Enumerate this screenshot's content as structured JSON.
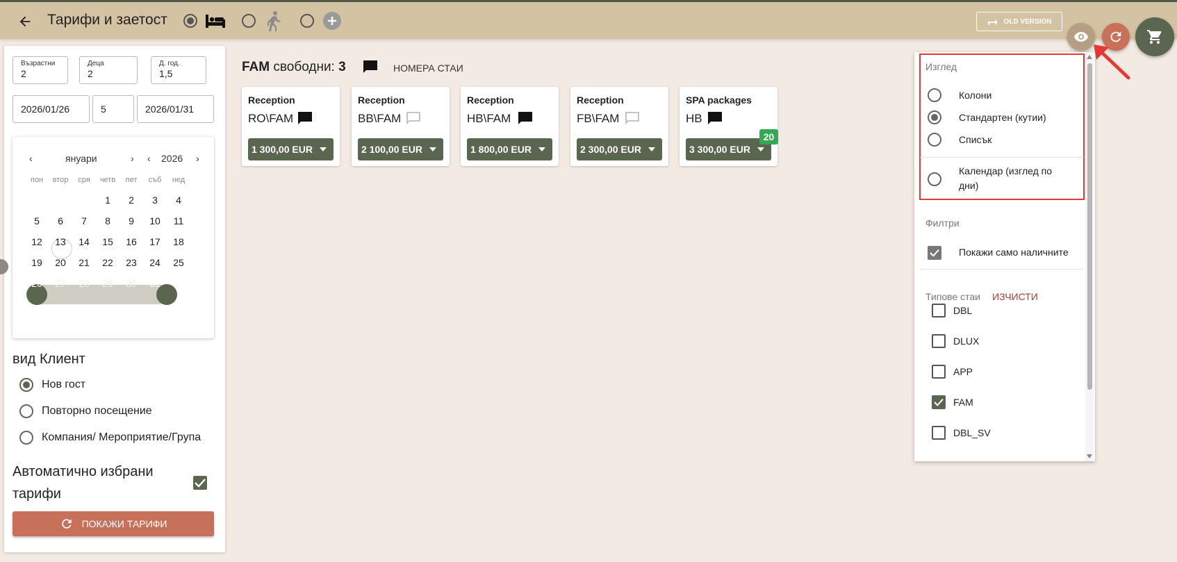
{
  "header": {
    "title": "Тарифи и заетост",
    "old_version_label": "OLD VERSION"
  },
  "search": {
    "adults_label": "Възрастни",
    "adults_value": "2",
    "children_label": "Деца",
    "children_value": "2",
    "child_age_label": "Д. год.",
    "child_age_value": "1,5",
    "date_from": "2026/01/26",
    "nights": "5",
    "date_to": "2026/01/31"
  },
  "calendar": {
    "month": "януари",
    "year": "2026",
    "weekdays": [
      "пон",
      "втор",
      "сря",
      "четв",
      "пет",
      "съб",
      "нед"
    ],
    "weeks": [
      [
        "",
        "",
        "",
        "1",
        "2",
        "3",
        "4"
      ],
      [
        "5",
        "6",
        "7",
        "8",
        "9",
        "10",
        "11"
      ],
      [
        "12",
        "13",
        "14",
        "15",
        "16",
        "17",
        "18"
      ],
      [
        "19",
        "20",
        "21",
        "22",
        "23",
        "24",
        "25"
      ],
      [
        "26",
        "27",
        "28",
        "29",
        "30",
        "31",
        ""
      ]
    ]
  },
  "client": {
    "title": "вид Клиент",
    "options": [
      "Нов гост",
      "Повторно посещение",
      "Компания/ Мероприятие/Група"
    ],
    "selected": "Нов гост",
    "auto_rates_label": "Автоматично избрани тарифи",
    "auto_rates_checked": true,
    "show_rates_label": "ПОКАЖИ ТАРИФИ"
  },
  "results": {
    "room_type": "FAM",
    "free_label": "свободни:",
    "free_count": "3",
    "rooms_link": "НОМЕРА СТАИ",
    "rates": [
      {
        "category": "Reception",
        "code": "RO\\FAM",
        "price": "1 300,00 EUR",
        "comment": "filled"
      },
      {
        "category": "Reception",
        "code": "BB\\FAM",
        "price": "2 100,00 EUR",
        "comment": "outline"
      },
      {
        "category": "Reception",
        "code": "HB\\FAM",
        "price": "1 800,00 EUR",
        "comment": "filled"
      },
      {
        "category": "Reception",
        "code": "FB\\FAM",
        "price": "2 300,00 EUR",
        "comment": "outline"
      },
      {
        "category": "SPA packages",
        "code": "HB",
        "price": "3 300,00 EUR",
        "comment": "filled",
        "badge": "20"
      }
    ]
  },
  "view_panel": {
    "view_heading": "Изглед",
    "view_options": [
      "Колони",
      "Стандартен (кутии)",
      "Списък"
    ],
    "calendar_option_line1": "Календар (изглед по",
    "calendar_option_line2": "дни)",
    "selected_view": "Стандартен (кутии)",
    "filters_heading": "Филтри",
    "only_available_label": "Покажи само наличните",
    "only_available_checked": true,
    "room_types_heading": "Типове стаи",
    "clear_label": "ИЗЧИСТИ",
    "room_types": [
      {
        "name": "DBL",
        "checked": false
      },
      {
        "name": "DLUX",
        "checked": false
      },
      {
        "name": "APP",
        "checked": false
      },
      {
        "name": "FAM",
        "checked": true
      },
      {
        "name": "DBL_SV",
        "checked": false
      }
    ]
  },
  "colors": {
    "topbar": "#d4c3a3",
    "primary": "#5b6650",
    "accent": "#c7715a",
    "background": "#f3ebe3",
    "highlight": "#e53935",
    "badge": "#35a853"
  }
}
